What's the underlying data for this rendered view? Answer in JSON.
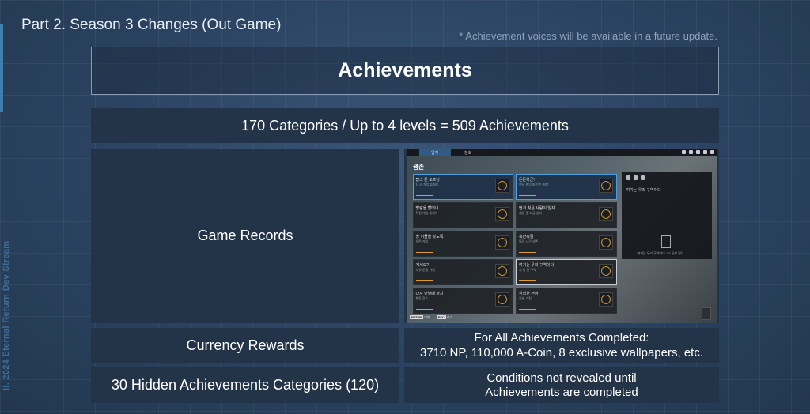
{
  "header": {
    "part_title": "Part 2. Season 3 Changes (Out Game)",
    "note": "* Achievement voices will be available in a future update.",
    "title": "Achievements"
  },
  "side_label": "II. 2024 Eternal Return Dev Stream",
  "rows": {
    "summary": "170 Categories / Up to 4 levels = 509 Achievements",
    "game_records_label": "Game Records",
    "currency_label": "Currency Rewards",
    "currency_line1": "For All Achievements Completed:",
    "currency_line2": "3710 NP, 110,000 A-Coin, 8 exclusive wallpapers, etc.",
    "hidden_label": "30 Hidden Achievements  Categories (120)",
    "hidden_line1": "Conditions not revealed until",
    "hidden_line2": "Achievements are completed"
  },
  "game_screenshot": {
    "tabs": [
      "업적",
      "칭호"
    ],
    "title": "생존",
    "cards": [
      {
        "title": "탑스 톤 오프닝",
        "sub": "탑 스 게임 플레이",
        "state": "selected"
      },
      {
        "title": "든든하군!",
        "sub": "연달 게임 중 든든 회복",
        "state": "selected"
      },
      {
        "title": "방랑을 할머니",
        "sub": "특정 게임 플레이",
        "state": "normal"
      },
      {
        "title": "먼저 찾은 사람이 임자",
        "sub": "게임 중 보급 상자",
        "state": "normal"
      },
      {
        "title": "방 이들을 맞도록",
        "sub": "생존 게임",
        "state": "normal"
      },
      {
        "title": "혹한축결",
        "sub": "특정 시간 생존",
        "state": "normal"
      },
      {
        "title": "게세요?",
        "sub": "부유 준을 가림",
        "state": "normal"
      },
      {
        "title": "여기는 우리 구역이다",
        "sub": "지 정 된 구역",
        "state": "highlight"
      },
      {
        "title": "다시 안날때 까지",
        "sub": "행동 감소",
        "state": "normal"
      },
      {
        "title": "위험한 전향",
        "sub": "전술 스킬",
        "state": "normal"
      }
    ],
    "panel_title": "여기는 우리 구역이다",
    "panel_footer": "여기는 우리 구역이다 1/3 달성 필요",
    "bottom_keys": [
      {
        "key": "ENTER",
        "label": "대화"
      },
      {
        "key": "ESC",
        "label": "취소"
      }
    ]
  }
}
